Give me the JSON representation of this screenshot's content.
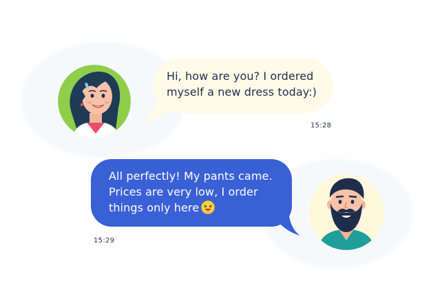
{
  "messages": [
    {
      "sender": "woman",
      "lines": [
        "Hi, how are you? I ordered",
        "myself a new dress today:)"
      ],
      "time": "15:28",
      "bubble_color": "#fffbe8",
      "text_color": "#1f2d4a"
    },
    {
      "sender": "man",
      "lines": [
        "All perfectly! My pants came.",
        "Prices are very low, I order",
        "things only here"
      ],
      "emoji": "laughing-face-icon",
      "time": "15:29",
      "bubble_color": "#3a60d6",
      "text_color": "#ffffff"
    }
  ],
  "colors": {
    "woman_avatar_bg": "#8fce4b",
    "man_avatar_bg": "#fff8dc",
    "accent_blue": "#3a60d6"
  }
}
